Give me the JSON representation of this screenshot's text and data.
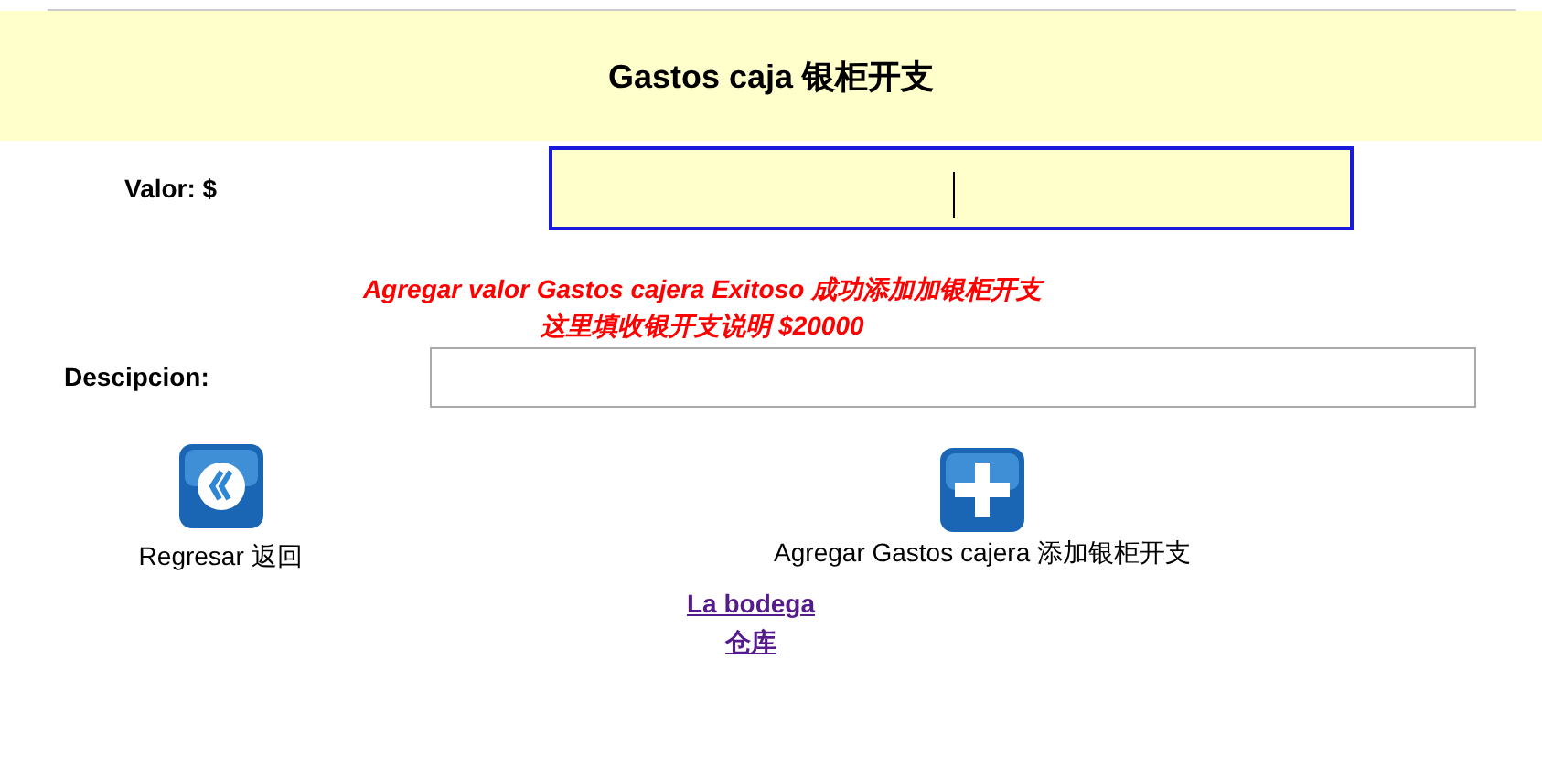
{
  "header": {
    "title": "Gastos caja 银柜开支"
  },
  "value_field": {
    "label": "Valor: $",
    "focused": true
  },
  "message": {
    "lines": [
      "Agregar valor Gastos cajera Exitoso 成功添加加银柜开支",
      "这里填收银开支说明 $20000"
    ]
  },
  "description_field": {
    "label": "Descipcion:",
    "focused": false
  },
  "actions": [
    {
      "kind": "back",
      "label": "Regresar 返回"
    },
    {
      "kind": "add",
      "label": "Agregar Gastos cajera 添加银柜开支"
    }
  ],
  "link": {
    "lines": [
      "La bodega ",
      "仓库"
    ]
  }
}
